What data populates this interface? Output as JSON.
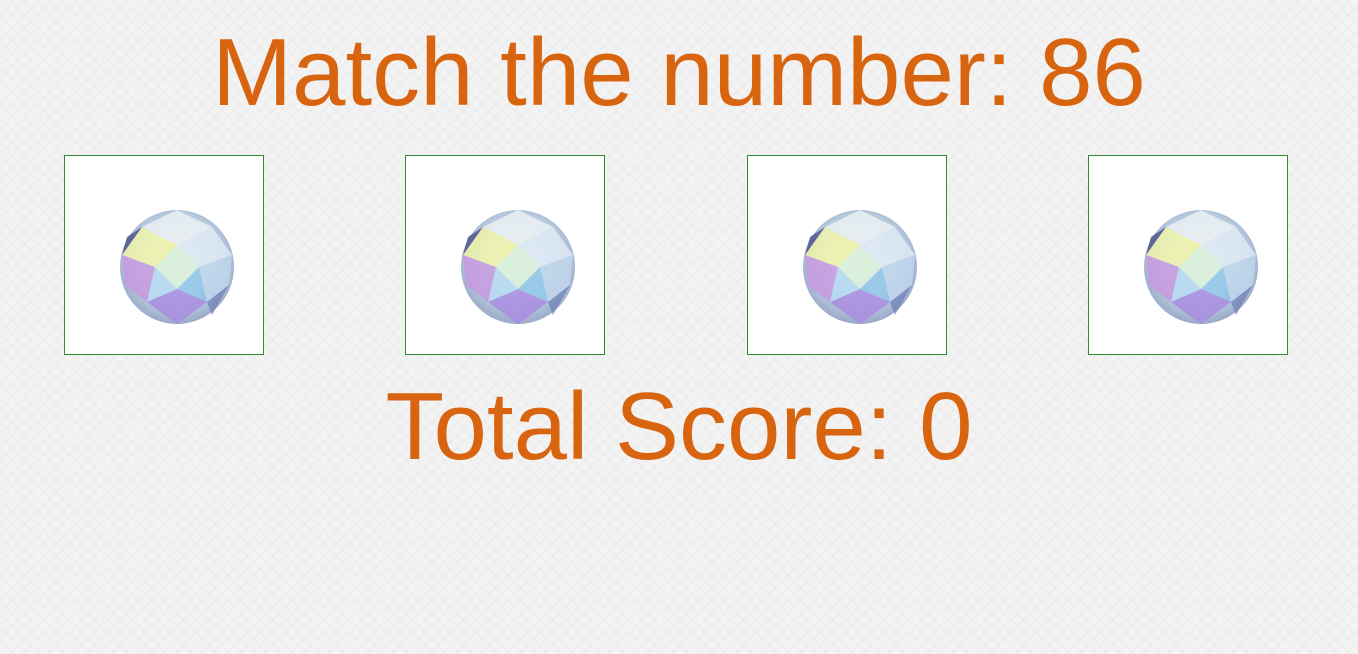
{
  "game": {
    "target_label": "Match the number:",
    "target_value": "86",
    "score_label": "Total Score:",
    "score_value": "0"
  },
  "crystals": [
    {
      "icon": "diamond-icon"
    },
    {
      "icon": "diamond-icon"
    },
    {
      "icon": "diamond-icon"
    },
    {
      "icon": "diamond-icon"
    }
  ],
  "colors": {
    "text": "#d9640f",
    "card_border": "#2e8b2e",
    "background": "#f3f3f3"
  }
}
